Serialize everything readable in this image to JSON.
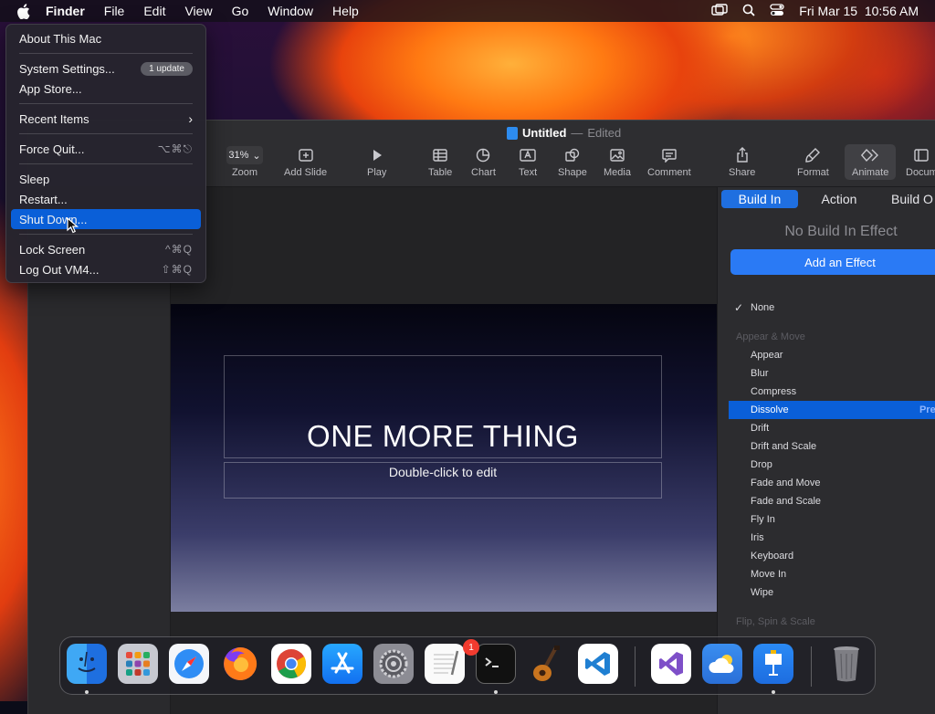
{
  "menubar": {
    "app": "Finder",
    "items": [
      "File",
      "Edit",
      "View",
      "Go",
      "Window",
      "Help"
    ],
    "datetime": "Fri Mar 15  10:56 AM"
  },
  "apple_menu": {
    "about": "About This Mac",
    "settings": "System Settings...",
    "update_badge": "1 update",
    "app_store": "App Store...",
    "recent": "Recent Items",
    "force_quit": "Force Quit...",
    "force_quit_sc": "⌥⌘⎋",
    "sleep": "Sleep",
    "restart": "Restart...",
    "shutdown": "Shut Down...",
    "lock": "Lock Screen",
    "lock_sc": "^⌘Q",
    "logout": "Log Out VM4...",
    "logout_sc": "⇧⌘Q"
  },
  "window": {
    "title": "Untitled",
    "title_sep": "—",
    "status": "Edited",
    "zoom": "31%",
    "toolbar": {
      "zoom": "Zoom",
      "add_slide": "Add Slide",
      "play": "Play",
      "table": "Table",
      "chart": "Chart",
      "text": "Text",
      "shape": "Shape",
      "media": "Media",
      "comment": "Comment",
      "share": "Share",
      "format": "Format",
      "animate": "Animate",
      "document": "Docum"
    }
  },
  "slide": {
    "title": "ONE MORE THING",
    "subtitle": "Double-click to edit"
  },
  "inspector": {
    "tabs": [
      "Build In",
      "Action",
      "Build O"
    ],
    "no_build": "No Build In Effect",
    "add_effect": "Add an Effect",
    "none": "None",
    "category1": "Appear & Move",
    "effects": [
      "Appear",
      "Blur",
      "Compress",
      "Dissolve",
      "Drift",
      "Drift and Scale",
      "Drop",
      "Fade and Move",
      "Fade and Scale",
      "Fly In",
      "Iris",
      "Keyboard",
      "Move In",
      "Wipe"
    ],
    "preview": "Previe",
    "category2": "Flip, Spin & Scale"
  },
  "dock": {
    "apps": [
      "Finder",
      "Launchpad",
      "Safari",
      "Firefox",
      "Chrome",
      "App Store",
      "System Settings",
      "TextEdit",
      "Terminal",
      "GarageBand",
      "VS Code",
      "Visual Studio",
      "Weather",
      "Keynote",
      "Trash"
    ],
    "settings_badge": "1"
  }
}
